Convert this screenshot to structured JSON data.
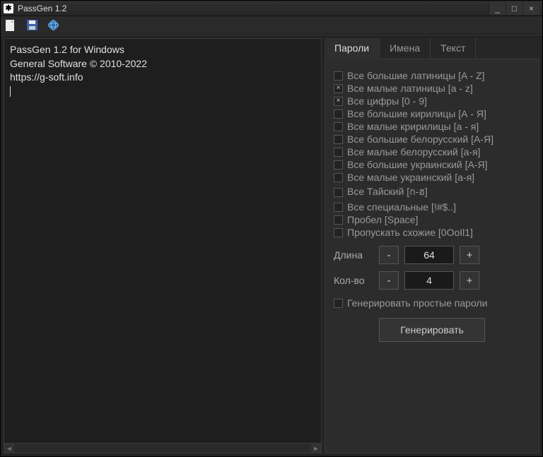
{
  "window": {
    "title": "PassGen 1.2",
    "controls": {
      "min": "_",
      "max": "□",
      "close": "×"
    }
  },
  "toolbar": {
    "items": [
      "new-file",
      "save-file",
      "web"
    ]
  },
  "left": {
    "lines": [
      "PassGen 1.2 for Windows",
      "General Software © 2010-2022",
      "https://g-soft.info"
    ]
  },
  "tabs": [
    {
      "id": "passwords",
      "label": "Пароли",
      "active": true
    },
    {
      "id": "names",
      "label": "Имена",
      "active": false
    },
    {
      "id": "text",
      "label": "Текст",
      "active": false
    }
  ],
  "options": [
    {
      "id": "upper-latin",
      "label": "Все большие латиницы [A - Z]",
      "checked": false
    },
    {
      "id": "lower-latin",
      "label": "Все малые латиницы [a - z]",
      "checked": true
    },
    {
      "id": "digits",
      "label": "Все цифры [0 - 9]",
      "checked": true
    },
    {
      "id": "upper-cyr",
      "label": "Все большие кирилицы [А - Я]",
      "checked": false
    },
    {
      "id": "lower-cyr",
      "label": "Все малые кририлицы [а - я]",
      "checked": false
    },
    {
      "id": "upper-bel",
      "label": "Все большие белорусский [А-Я]",
      "checked": false
    },
    {
      "id": "lower-bel",
      "label": "Все малые белорусский [а-я]",
      "checked": false
    },
    {
      "id": "upper-ukr",
      "label": "Все большие украинский [А-Я]",
      "checked": false
    },
    {
      "id": "lower-ukr",
      "label": "Все малые украинский [а-я]",
      "checked": false
    },
    {
      "id": "thai",
      "label": "Все Тайский [ก-ฮ]",
      "checked": false
    },
    {
      "id": "special",
      "label": "Все специальные [!#$..]",
      "checked": false
    },
    {
      "id": "space",
      "label": "Пробел [Space]",
      "checked": false
    },
    {
      "id": "skip-similar",
      "label": "Пропускать схожие [0OoIl1]",
      "checked": false
    }
  ],
  "length": {
    "label": "Длина",
    "value": "64",
    "minus": "-",
    "plus": "+"
  },
  "count": {
    "label": "Кол-во",
    "value": "4",
    "minus": "-",
    "plus": "+"
  },
  "simple": {
    "label": "Генерировать простые пароли",
    "checked": false
  },
  "generate": {
    "label": "Генерировать"
  }
}
